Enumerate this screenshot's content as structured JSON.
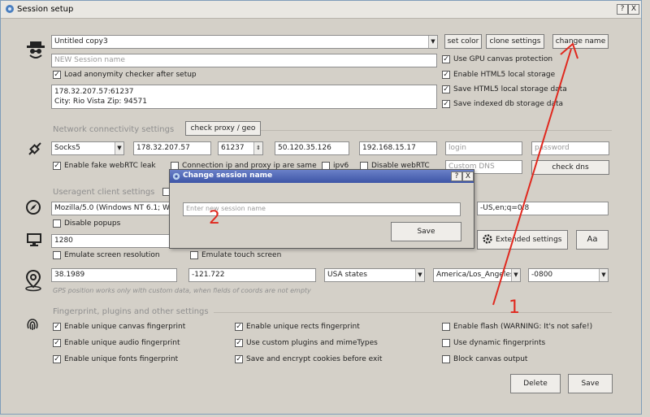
{
  "window": {
    "title": "Session setup",
    "help": "?",
    "close": "X"
  },
  "profile": {
    "session_select": "Untitled copy3",
    "name_placeholder": "NEW Session name",
    "load_checker_label": "Load anonymity checker after setup",
    "proxy_info_line1": "178.32.207.57:61237",
    "proxy_info_line2": "City: Rio Vista Zip: 94571",
    "set_color": "set color",
    "clone_settings": "clone settings",
    "change_name": "change name",
    "options": [
      {
        "label": "Use GPU canvas protection",
        "checked": true
      },
      {
        "label": "Enable HTML5 local storage",
        "checked": true
      },
      {
        "label": "Save HTML5 local storage data",
        "checked": true
      },
      {
        "label": "Save indexed db storage data",
        "checked": true
      }
    ]
  },
  "network": {
    "section_title": "Network connectivity settings",
    "check_proxy": "check proxy / geo",
    "proxy_type": "Socks5",
    "ip": "178.32.207.57",
    "port": "61237",
    "webrtc_ip": "50.120.35.126",
    "local_ip": "192.168.15.17",
    "login_placeholder": "login",
    "password_placeholder": "password",
    "fake_webrtc_label": "Enable fake webRTC leak",
    "conn_same_label": "Connection ip and proxy ip are same",
    "ipv6_label": "ipv6",
    "disable_webrtc_label": "Disable webRTC",
    "custom_dns_placeholder": "Custom DNS",
    "check_dns": "check dns"
  },
  "useragent": {
    "section_title": "Useragent client settings",
    "ua_value": "Mozilla/5.0 (Windows NT 6.1; Win",
    "lang_value": "-US,en;q=0.8",
    "disable_popups": "Disable popups",
    "width": "1280",
    "extended_settings": "Extended settings",
    "aa_button": "Aa",
    "emulate_resolution": "Emulate screen resolution",
    "emulate_touch": "Emulate touch screen"
  },
  "geo": {
    "lat": "38.1989",
    "lon": "-121.722",
    "country": "USA states",
    "timezone": "America/Los_Angeles",
    "offset": "-0800",
    "note": "GPS position works only with custom data, when fields of coords are not empty"
  },
  "fingerprint": {
    "section_title": "Fingerprint, plugins and other settings",
    "col1": [
      {
        "label": "Enable unique canvas fingerprint",
        "checked": true
      },
      {
        "label": "Enable unique audio fingerprint",
        "checked": true
      },
      {
        "label": "Enable unique fonts fingerprint",
        "checked": true
      }
    ],
    "col2": [
      {
        "label": "Enable unique rects fingerprint",
        "checked": true
      },
      {
        "label": "Use custom plugins and mimeTypes",
        "checked": true
      },
      {
        "label": "Save and encrypt cookies before exit",
        "checked": true
      }
    ],
    "col3": [
      {
        "label": "Enable flash (WARNING: It's not safe!)",
        "checked": false
      },
      {
        "label": "Use dynamic fingerprints",
        "checked": false
      },
      {
        "label": "Block canvas output",
        "checked": false
      }
    ]
  },
  "footer": {
    "delete": "Delete",
    "save": "Save"
  },
  "dialog": {
    "title": "Change session name",
    "input_placeholder": "Enter new session name",
    "save": "Save",
    "help": "?",
    "close": "X"
  },
  "annotations": {
    "one": "1",
    "two": "2",
    "color": "#e0281e"
  }
}
